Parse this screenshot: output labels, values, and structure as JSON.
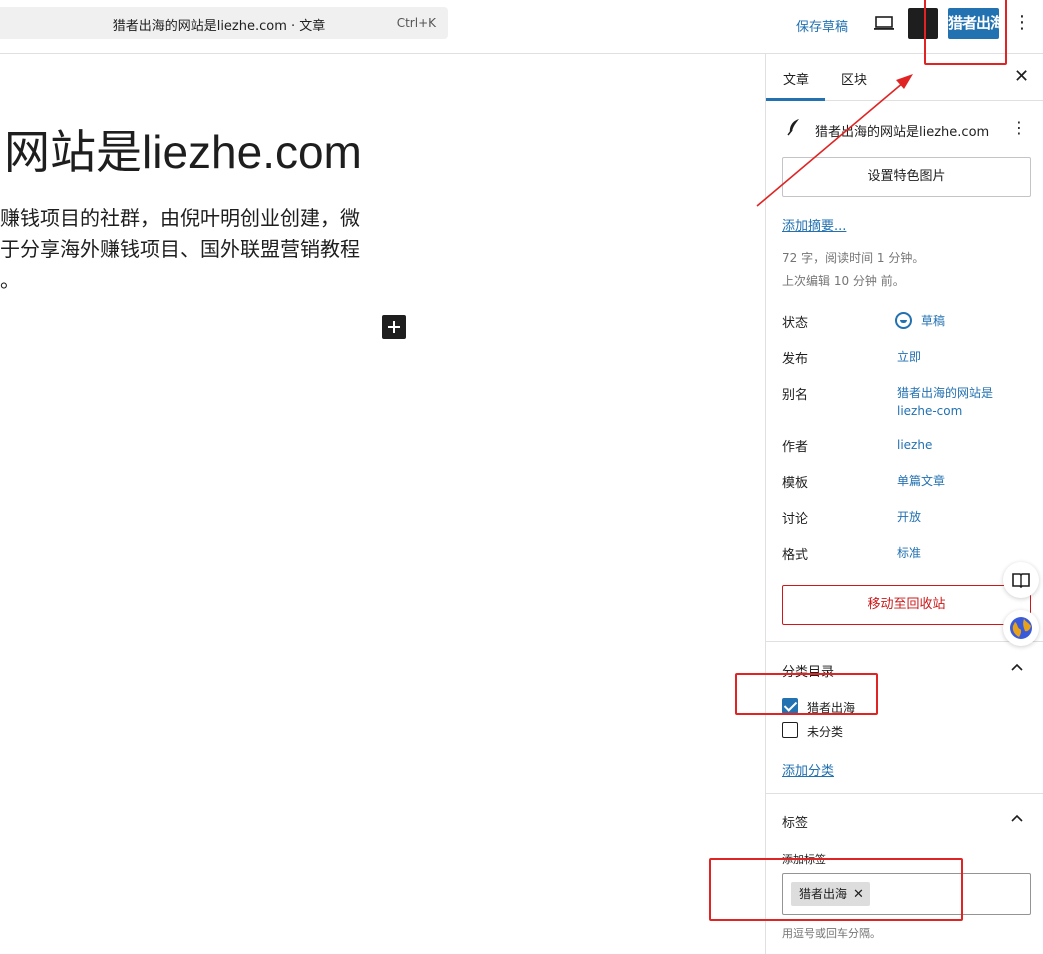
{
  "topbar": {
    "command_title": "猎者出海的网站是liezhe.com · 文章",
    "command_shortcut": "Ctrl+K",
    "save_draft": "保存草稿",
    "publish_label": "猎者出海",
    "more": "⋮"
  },
  "editor": {
    "title": "网站是liezhe.com",
    "paragraph_lines": [
      "赚钱项目的社群，由倪叶明创业创建，微",
      "于分享海外赚钱项目、国外联盟营销教程",
      "。"
    ]
  },
  "sidebar": {
    "tabs": {
      "post": "文章",
      "block": "区块"
    },
    "close": "✕",
    "post_title": "猎者出海的网站是liezhe.com",
    "featured_image": "设置特色图片",
    "add_excerpt": "添加摘要...",
    "meta_words": "72 字，阅读时间 1 分钟。",
    "meta_edited": "上次编辑 10 分钟 前。",
    "rows": {
      "status": {
        "label": "状态",
        "value": "草稿"
      },
      "publish": {
        "label": "发布",
        "value": "立即"
      },
      "slug": {
        "label": "别名",
        "value_line1": "猎者出海的网站是",
        "value_line2": "liezhe-com"
      },
      "author": {
        "label": "作者",
        "value": "liezhe"
      },
      "template": {
        "label": "模板",
        "value": "单篇文章"
      },
      "discussion": {
        "label": "讨论",
        "value": "开放"
      },
      "format": {
        "label": "格式",
        "value": "标准"
      }
    },
    "trash": "移动至回收站",
    "categories": {
      "title": "分类目录",
      "items": [
        {
          "label": "猎者出海",
          "checked": true
        },
        {
          "label": "未分类",
          "checked": false
        }
      ],
      "add": "添加分类"
    },
    "tags": {
      "title": "标签",
      "add_label": "添加标签",
      "chip": "猎者出海",
      "remove": "✕",
      "help": "用逗号或回车分隔。"
    }
  },
  "colors": {
    "accent": "#2271b1",
    "danger": "#cc1818",
    "annotation": "#e02424"
  },
  "icons": [
    "preview-icon",
    "feather-icon",
    "status-draft-icon",
    "chevron-up-icon",
    "book-icon",
    "globe-icon"
  ]
}
